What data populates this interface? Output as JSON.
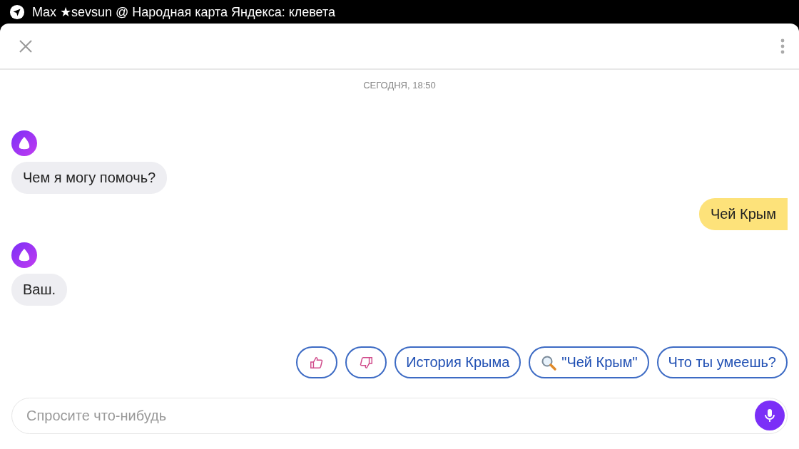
{
  "status_bar": {
    "title": "Max ★sevsun @ Народная карта Яндекса: клевета"
  },
  "chat": {
    "date": "СЕГОДНЯ, 18:50",
    "messages": [
      {
        "kind": "assistant",
        "text": "Чем я могу помочь?"
      },
      {
        "kind": "user",
        "text": "Чей Крым"
      },
      {
        "kind": "assistant",
        "text": "Ваш."
      }
    ]
  },
  "suggestions": [
    {
      "kind": "like"
    },
    {
      "kind": "dislike"
    },
    {
      "kind": "text",
      "label": "История Крыма"
    },
    {
      "kind": "search",
      "label": "\"Чей Крым\""
    },
    {
      "kind": "text",
      "label": "Что ты умеешь?"
    }
  ],
  "input": {
    "placeholder": "Спросите что-нибудь"
  }
}
